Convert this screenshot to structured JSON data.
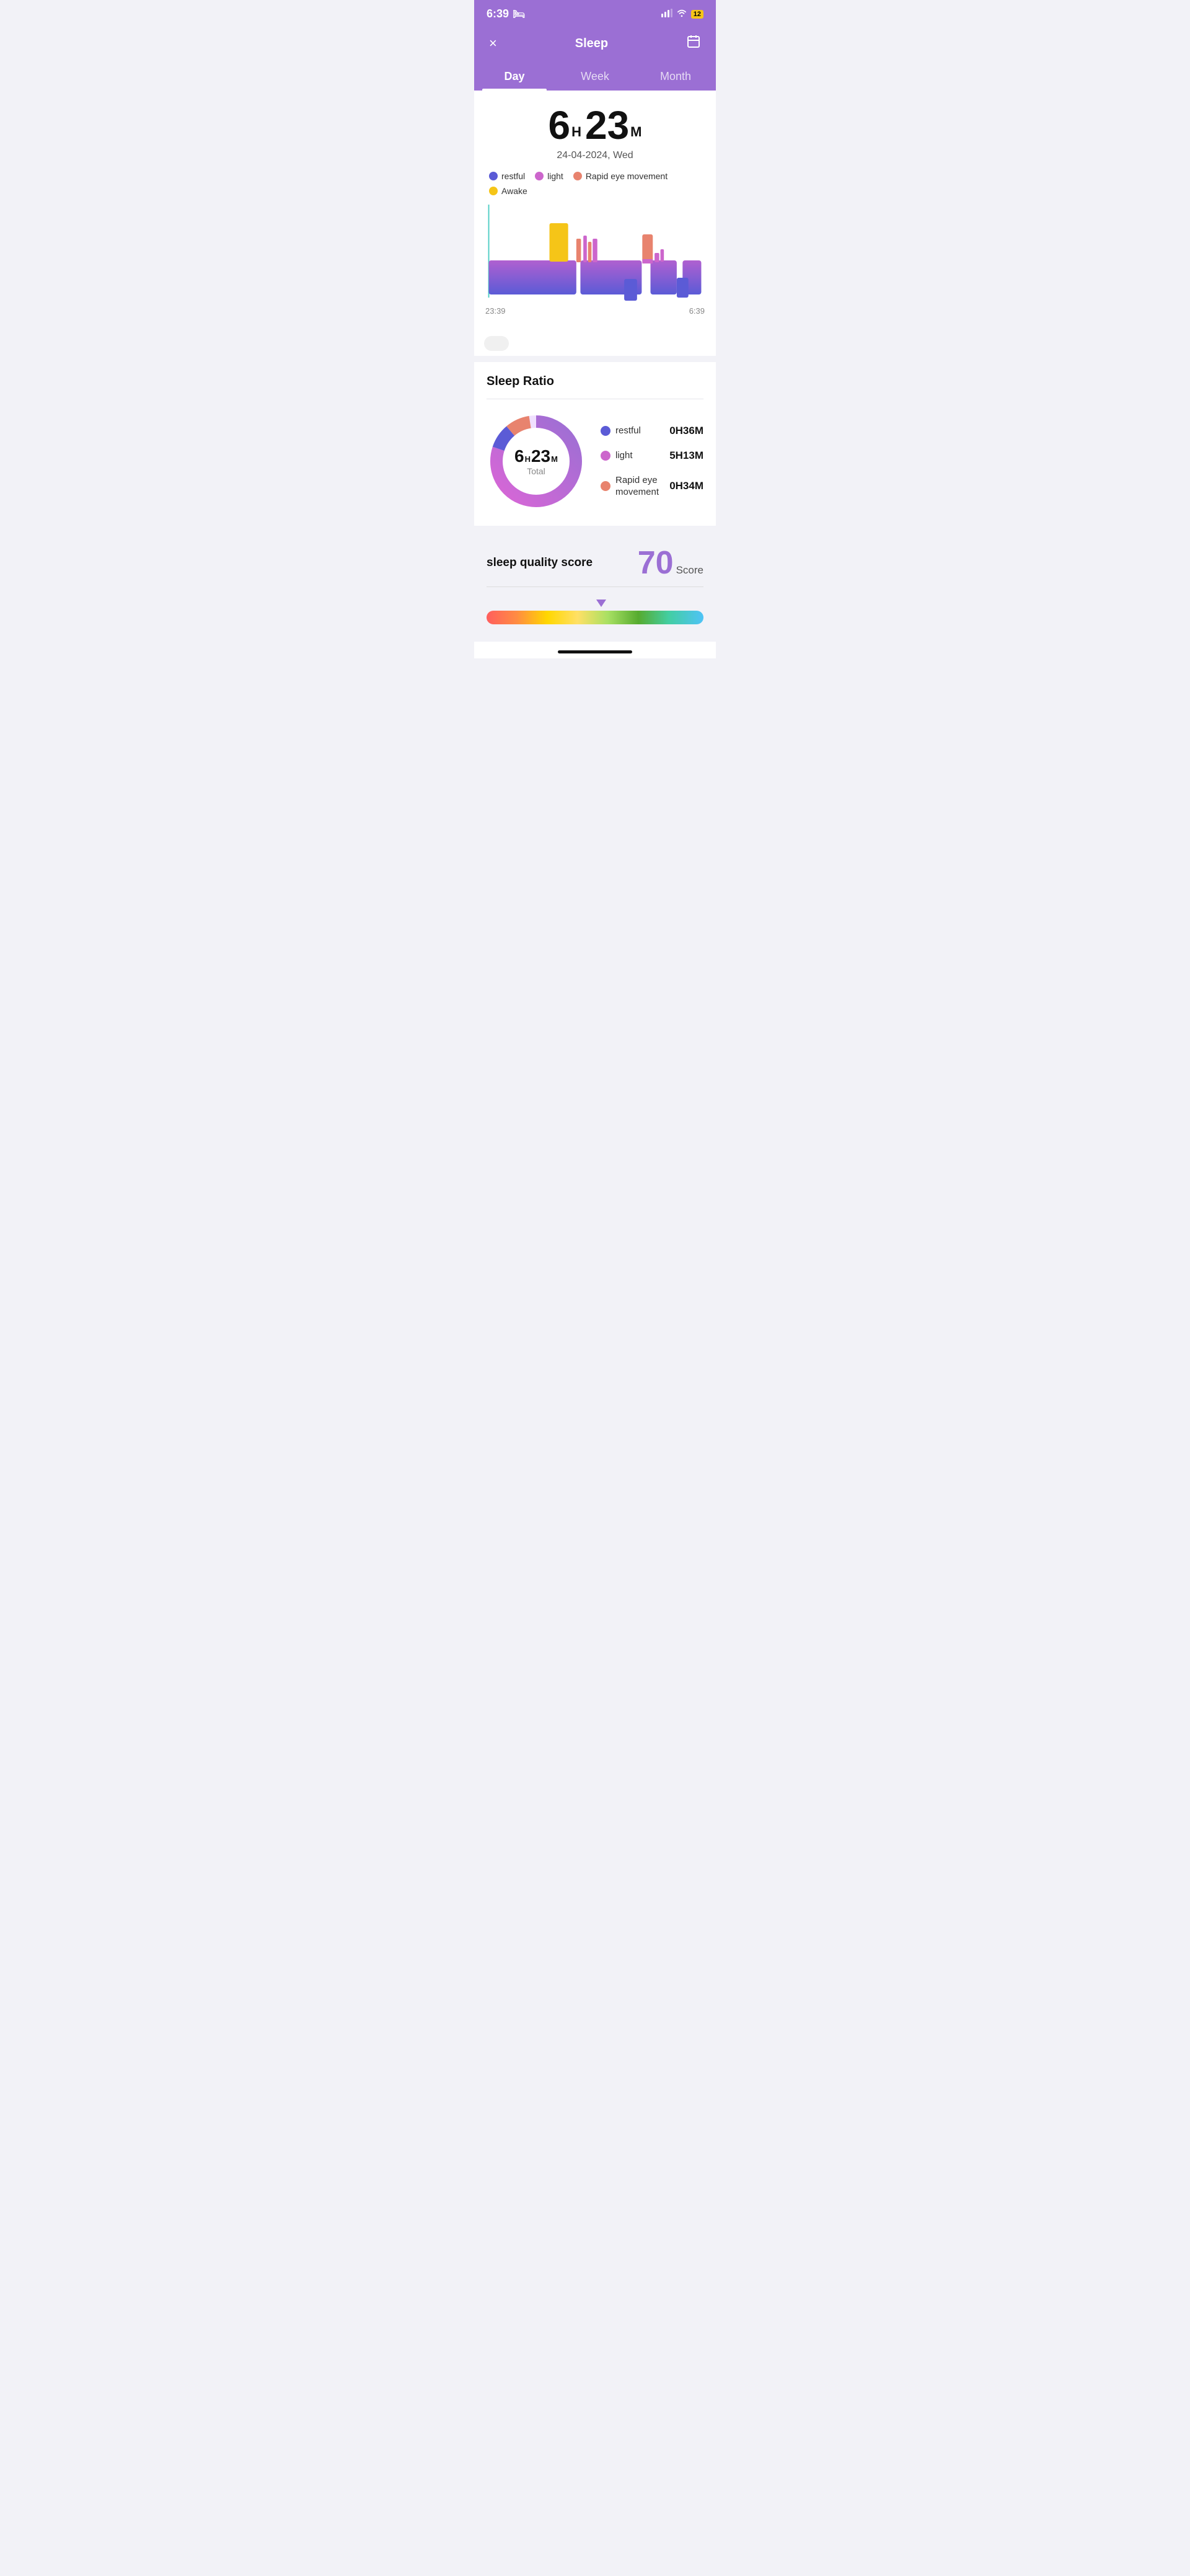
{
  "statusBar": {
    "time": "6:39",
    "battery": "12"
  },
  "header": {
    "title": "Sleep",
    "closeLabel": "×",
    "calendarLabel": "📅"
  },
  "tabs": [
    {
      "id": "day",
      "label": "Day",
      "active": true
    },
    {
      "id": "week",
      "label": "Week",
      "active": false
    },
    {
      "id": "month",
      "label": "Month",
      "active": false
    }
  ],
  "sleepDuration": {
    "hours": "6",
    "hoursUnit": "H",
    "minutes": "23",
    "minutesUnit": "M",
    "date": "24-04-2024, Wed"
  },
  "legend": [
    {
      "id": "restful",
      "label": "restful",
      "color": "#5b5bd6"
    },
    {
      "id": "light",
      "label": "light",
      "color": "#cc66cc"
    },
    {
      "id": "rem",
      "label": "Rapid eye movement",
      "color": "#e8836e"
    },
    {
      "id": "awake",
      "label": "Awake",
      "color": "#f5c518"
    }
  ],
  "chartTimes": {
    "start": "23:39",
    "end": "6:39"
  },
  "sleepRatio": {
    "title": "Sleep Ratio",
    "total": {
      "hours": "6",
      "hoursUnit": "H",
      "minutes": "23",
      "minutesUnit": "M",
      "label": "Total"
    },
    "items": [
      {
        "id": "restful",
        "label": "restful",
        "color": "#5b5bd6",
        "value": "0H36M"
      },
      {
        "id": "light",
        "label": "light",
        "color": "#cc66cc",
        "value": "5H13M"
      },
      {
        "id": "rem",
        "label": "Rapid eye\nmovement",
        "labelLine1": "Rapid eye",
        "labelLine2": "movement",
        "color": "#e8836e",
        "value": "0H34M"
      }
    ]
  },
  "sleepQuality": {
    "title": "sleep quality score",
    "score": "70",
    "scoreLabel": "Score"
  },
  "colors": {
    "purple": "#9b6fd4",
    "blue": "#5b5bd6",
    "pink": "#cc66cc",
    "orange": "#e8836e",
    "yellow": "#f5c518"
  }
}
